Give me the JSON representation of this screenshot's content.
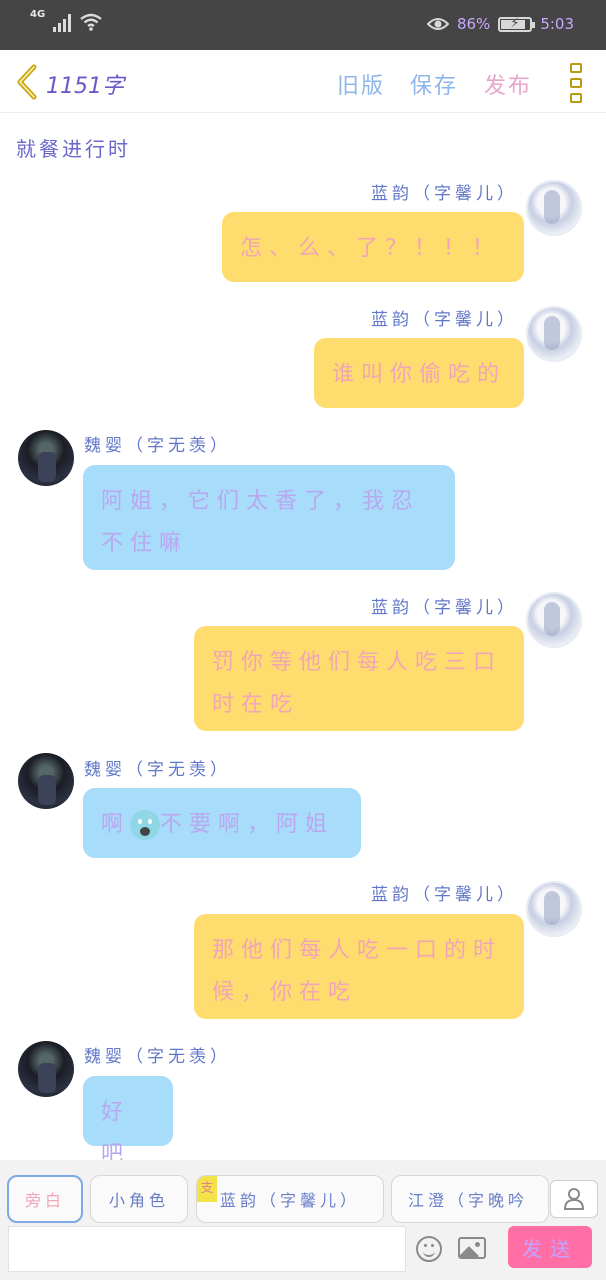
{
  "status_bar": {
    "network": "4G",
    "battery_percent": "86%",
    "time": "5:03",
    "battery_level": 0.86
  },
  "header": {
    "word_count": "1151字",
    "buttons": [
      {
        "label": "旧版"
      },
      {
        "label": "保存"
      },
      {
        "label": "发布"
      }
    ]
  },
  "chat": {
    "scene_title": "就餐进行时",
    "messages": [
      {
        "speaker": "蓝韵（字馨儿）",
        "text": "怎、么、了？！！！",
        "side": "right",
        "color": "yellow"
      },
      {
        "speaker": "蓝韵（字馨儿）",
        "text": "谁叫你偷吃的",
        "side": "right",
        "color": "yellow"
      },
      {
        "speaker": "魏婴（字无羡）",
        "text": "阿姐，它们太香了，我忍不住嘛",
        "side": "left",
        "color": "blue"
      },
      {
        "speaker": "蓝韵（字馨儿）",
        "text": "罚你等他们每人吃三口时在吃",
        "side": "right",
        "color": "yellow"
      },
      {
        "speaker": "魏婴（字无羡）",
        "text_before": "啊",
        "emoji": "screaming-face",
        "text_after": "不要啊，阿姐",
        "side": "left",
        "color": "blue"
      },
      {
        "speaker": "蓝韵（字馨儿）",
        "text": "那他们每人吃一口的时候，你在吃",
        "side": "right",
        "color": "yellow"
      },
      {
        "speaker": "魏婴（字无羡）",
        "text": "好吧",
        "side": "left",
        "color": "blue"
      }
    ]
  },
  "roles": {
    "items": [
      {
        "label": "旁白",
        "active": true
      },
      {
        "label": "小角色",
        "active": false
      },
      {
        "label": "蓝韵（字馨儿）",
        "tag": "支",
        "active": false
      },
      {
        "label": "江澄（字晚吟",
        "active": false
      }
    ]
  },
  "input": {
    "placeholder": "",
    "send_label": "发送"
  },
  "colors": {
    "yellow_bubble": "#ffdc6e",
    "blue_bubble": "#a8dcfb",
    "send_button": "#ff6fa5",
    "status_bar": "#454545"
  }
}
